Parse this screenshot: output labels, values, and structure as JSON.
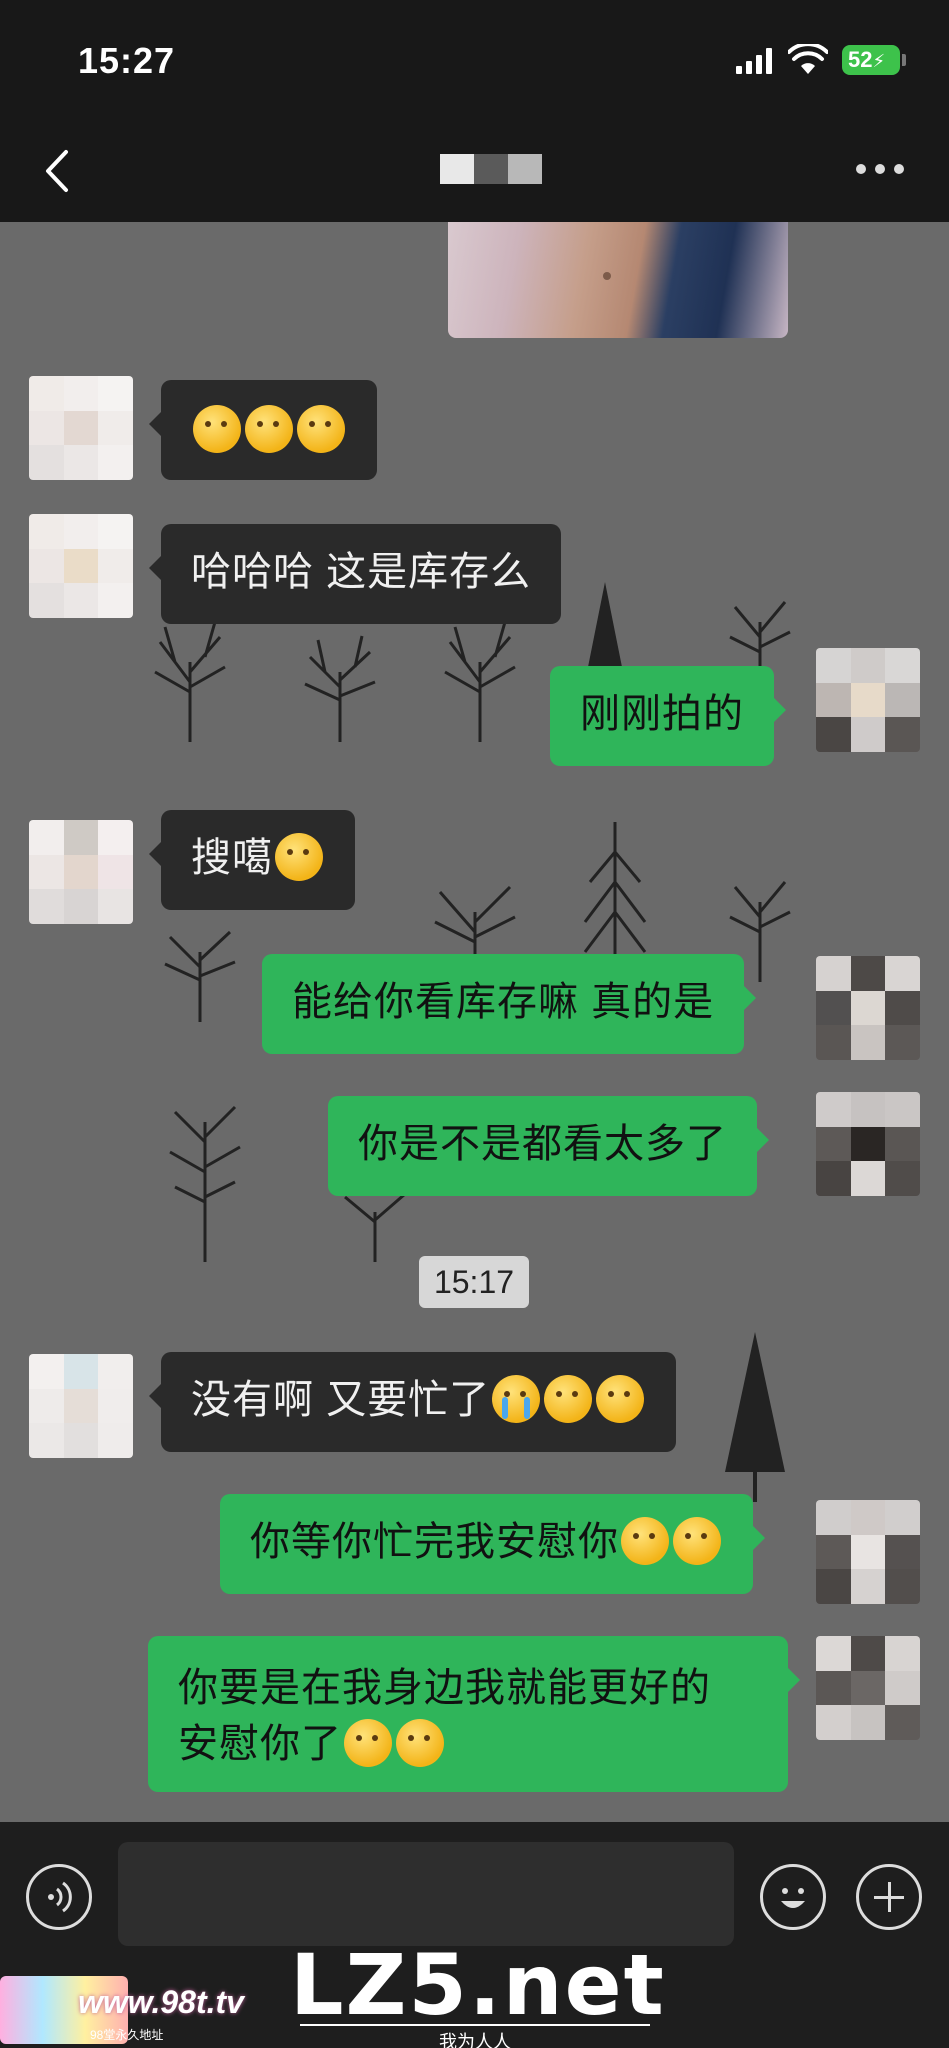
{
  "status_bar": {
    "time": "15:27",
    "battery": "52"
  },
  "nav": {
    "contact_name": ""
  },
  "chat": {
    "messages": [
      {
        "side": "in",
        "text": "",
        "emoji": [
          "eye-hand-emoji",
          "eye-hand-emoji",
          "eye-hand-emoji"
        ]
      },
      {
        "side": "in",
        "text": "哈哈哈   这是库存么"
      },
      {
        "side": "out",
        "text": "刚刚拍的"
      },
      {
        "side": "in",
        "text": "搜噶",
        "emoji": [
          "kiss-emoji"
        ]
      },
      {
        "side": "out",
        "text": "能给你看库存嘛 真的是"
      },
      {
        "side": "out",
        "text": "你是不是都看太多了"
      },
      {
        "side": "in",
        "text": "没有啊   又要忙了",
        "emoji": [
          "crying-emoji",
          "laugh-cry-emoji",
          "laugh-cry-emoji"
        ]
      },
      {
        "side": "out",
        "text": "你等你忙完我安慰你",
        "emoji": [
          "hand-over-mouth-emoji",
          "hand-over-mouth-emoji"
        ]
      },
      {
        "side": "out",
        "text_line1": "你要是在我身边我就能更好的",
        "text_line2": "安慰你了",
        "emoji": [
          "hand-over-mouth-emoji",
          "hand-over-mouth-emoji"
        ]
      }
    ],
    "timestamp": "15:17"
  },
  "input_bar": {
    "placeholder": ""
  },
  "watermarks": {
    "left": "www.98t.tv",
    "left_sub": "98堂永久地址",
    "main": "LZ5.net",
    "main_sub": "我为人人"
  },
  "colors": {
    "outgoing_bubble": "#2fb55a",
    "incoming_bubble": "#2a2a2a",
    "chat_background": "#6a6a6a",
    "battery": "#3dc24b"
  }
}
